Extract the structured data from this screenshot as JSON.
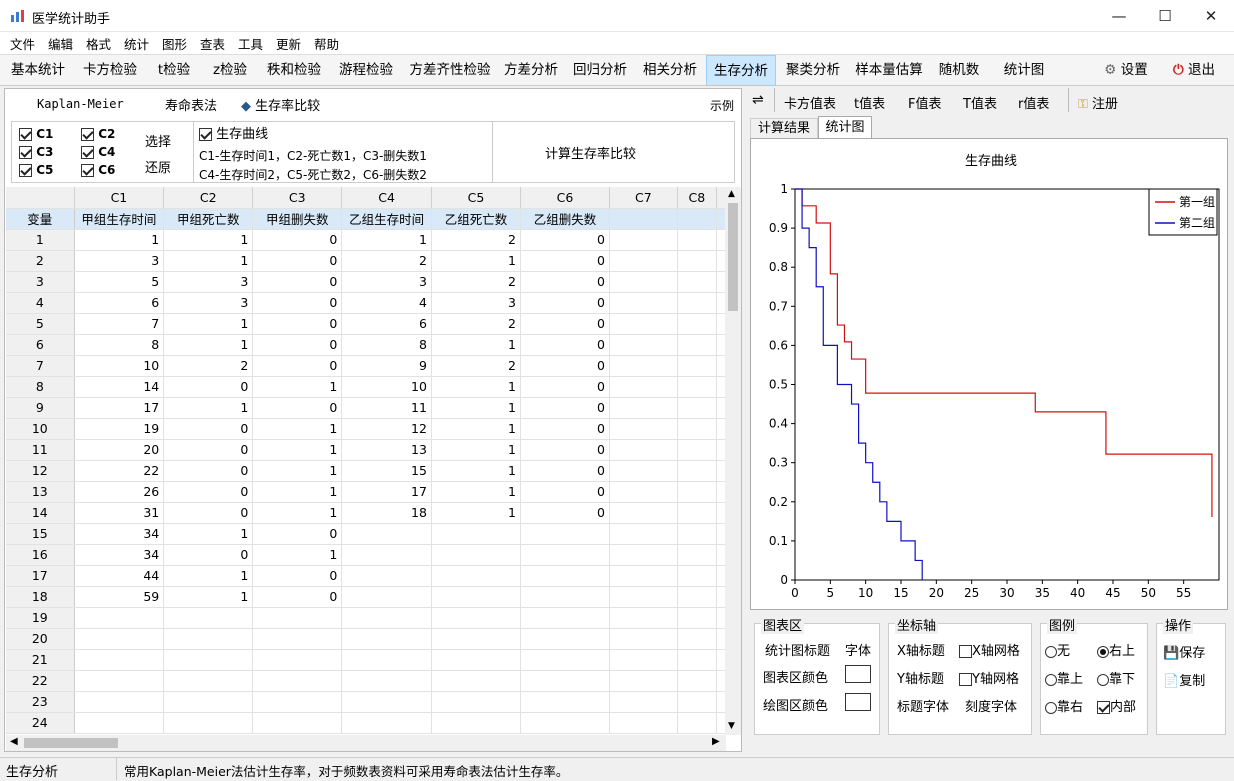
{
  "window": {
    "title": "医学统计助手"
  },
  "menu": [
    "文件",
    "编辑",
    "格式",
    "统计",
    "图形",
    "查表",
    "工具",
    "更新",
    "帮助"
  ],
  "func_tabs": [
    "基本统计",
    "卡方检验",
    "t检验",
    "z检验",
    "秩和检验",
    "游程检验",
    "方差齐性检验",
    "方差分析",
    "回归分析",
    "相关分析",
    "生存分析",
    "聚类分析",
    "样本量估算",
    "随机数",
    "统计图"
  ],
  "active_tab": "生存分析",
  "settings_label": "设置",
  "exit_label": "退出",
  "method_bar": {
    "kaplan": "Kaplan-Meier",
    "life": "寿命表法",
    "compare": "生存率比较",
    "example": "示例"
  },
  "columns_select": {
    "items": [
      {
        "label": "C1",
        "checked": true
      },
      {
        "label": "C2",
        "checked": true
      },
      {
        "label": "C3",
        "checked": true
      },
      {
        "label": "C4",
        "checked": true
      },
      {
        "label": "C5",
        "checked": true
      },
      {
        "label": "C6",
        "checked": true
      }
    ],
    "select_label": "选择",
    "restore_label": "还原"
  },
  "curve_option": {
    "label": "生存曲线",
    "checked": true,
    "line1": "C1-生存时间1，C2-死亡数1，C3-删失数1",
    "line2": "C4-生存时间2，C5-死亡数2，C6-删失数2"
  },
  "compute_label": "计算生存率比较",
  "grid": {
    "col_headers": [
      "C1",
      "C2",
      "C3",
      "C4",
      "C5",
      "C6",
      "C7",
      "C8"
    ],
    "var_label": "变量",
    "names": [
      "甲组生存时间",
      "甲组死亡数",
      "甲组删失数",
      "乙组生存时间",
      "乙组死亡数",
      "乙组删失数",
      "",
      ""
    ],
    "row_numbers": [
      "1",
      "2",
      "3",
      "4",
      "5",
      "6",
      "7",
      "8",
      "9",
      "10",
      "11",
      "12",
      "13",
      "14",
      "15",
      "16",
      "17",
      "18",
      "19",
      "20",
      "21",
      "22",
      "23",
      "24"
    ],
    "rows": [
      [
        "1",
        "1",
        "0",
        "1",
        "2",
        "0"
      ],
      [
        "3",
        "1",
        "0",
        "2",
        "1",
        "0"
      ],
      [
        "5",
        "3",
        "0",
        "3",
        "2",
        "0"
      ],
      [
        "6",
        "3",
        "0",
        "4",
        "3",
        "0"
      ],
      [
        "7",
        "1",
        "0",
        "6",
        "2",
        "0"
      ],
      [
        "8",
        "1",
        "0",
        "8",
        "1",
        "0"
      ],
      [
        "10",
        "2",
        "0",
        "9",
        "2",
        "0"
      ],
      [
        "14",
        "0",
        "1",
        "10",
        "1",
        "0"
      ],
      [
        "17",
        "1",
        "0",
        "11",
        "1",
        "0"
      ],
      [
        "19",
        "0",
        "1",
        "12",
        "1",
        "0"
      ],
      [
        "20",
        "0",
        "1",
        "13",
        "1",
        "0"
      ],
      [
        "22",
        "0",
        "1",
        "15",
        "1",
        "0"
      ],
      [
        "26",
        "0",
        "1",
        "17",
        "1",
        "0"
      ],
      [
        "31",
        "0",
        "1",
        "18",
        "1",
        "0"
      ],
      [
        "34",
        "1",
        "0",
        "",
        "",
        ""
      ],
      [
        "34",
        "0",
        "1",
        "",
        "",
        ""
      ],
      [
        "44",
        "1",
        "0",
        "",
        "",
        ""
      ],
      [
        "59",
        "1",
        "0",
        "",
        "",
        ""
      ]
    ]
  },
  "right_toolbar": [
    "卡方值表",
    "t值表",
    "F值表",
    "T值表",
    "r值表"
  ],
  "register_label": "注册",
  "result_tabs": [
    "计算结果",
    "统计图"
  ],
  "active_result_tab": "统计图",
  "chart_data": {
    "type": "line",
    "title": "生存曲线",
    "xlabel": "",
    "ylabel": "",
    "xlim": [
      0,
      60
    ],
    "ylim": [
      0,
      1
    ],
    "x_ticks": [
      0,
      5,
      10,
      15,
      20,
      25,
      30,
      35,
      40,
      45,
      50,
      55
    ],
    "y_ticks": [
      0,
      0.1,
      0.2,
      0.3,
      0.4,
      0.5,
      0.6,
      0.7,
      0.8,
      0.9,
      1
    ],
    "legend_position": "top-right-inside",
    "series": [
      {
        "name": "第一组",
        "color": "#d01010",
        "step_x": [
          0,
          1,
          3,
          5,
          6,
          7,
          8,
          10,
          34,
          44,
          59
        ],
        "step_y": [
          1,
          0.957,
          0.913,
          0.783,
          0.652,
          0.609,
          0.565,
          0.478,
          0.43,
          0.322,
          0.161,
          0
        ]
      },
      {
        "name": "第二组",
        "color": "#1010c0",
        "step_x": [
          0,
          1,
          2,
          3,
          4,
          6,
          8,
          9,
          10,
          11,
          12,
          13,
          15,
          17,
          18
        ],
        "step_y": [
          1,
          0.9,
          0.85,
          0.75,
          0.6,
          0.5,
          0.45,
          0.35,
          0.3,
          0.25,
          0.2,
          0.15,
          0.1,
          0.05,
          0
        ]
      }
    ]
  },
  "chart_controls": {
    "area": {
      "title": "图表区",
      "stat_title": "统计图标题",
      "font": "字体",
      "area_color": "图表区颜色",
      "plot_color": "绘图区颜色"
    },
    "axis": {
      "title": "坐标轴",
      "x_title": "X轴标题",
      "x_grid": "X轴网格",
      "y_title": "Y轴标题",
      "y_grid": "Y轴网格",
      "title_font": "标题字体",
      "tick_font": "刻度字体"
    },
    "legend": {
      "title": "图例",
      "none": "无",
      "top_right": "右上",
      "top": "靠上",
      "bottom": "靠下",
      "right": "靠右",
      "inside": "内部"
    },
    "ops": {
      "title": "操作",
      "save": "保存",
      "copy": "复制"
    }
  },
  "status": {
    "left": "生存分析",
    "message": "常用Kaplan-Meier法估计生存率，对于频数表资料可采用寿命表法估计生存率。"
  }
}
